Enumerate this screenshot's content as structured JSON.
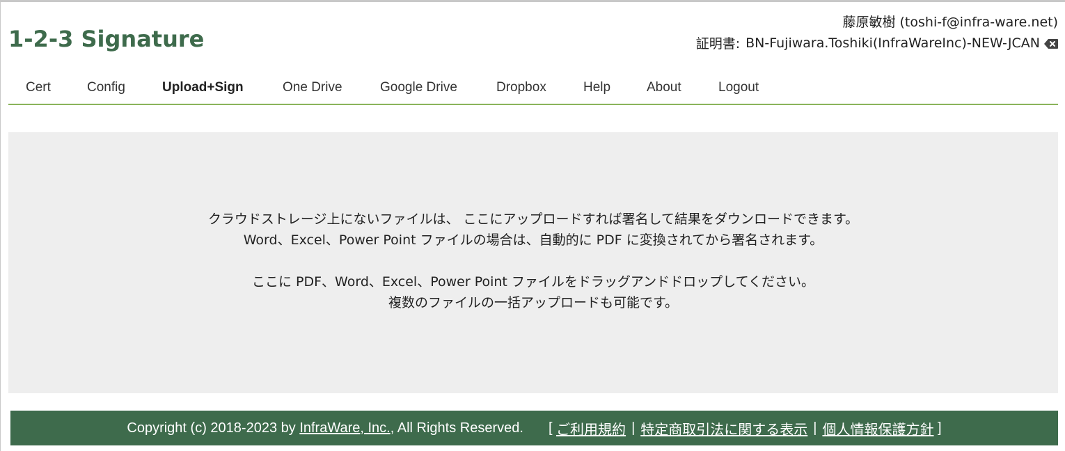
{
  "header": {
    "app_title": "1-2-3 Signature",
    "user": "藤原敏樹 (toshi-f@infra-ware.net)",
    "cert_label": "証明書:",
    "cert_name": "BN-Fujiwara.Toshiki(InfraWareInc)-NEW-JCAN",
    "cert_clear_icon": "backspace-icon"
  },
  "nav": {
    "items": [
      {
        "label": "Cert"
      },
      {
        "label": "Config"
      },
      {
        "label": "Upload+Sign",
        "active": true
      },
      {
        "label": "One Drive"
      },
      {
        "label": "Google Drive"
      },
      {
        "label": "Dropbox"
      },
      {
        "label": "Help"
      },
      {
        "label": "About"
      },
      {
        "label": "Logout"
      }
    ]
  },
  "drop_zone": {
    "line1": "クラウドストレージ上にないファイルは、 ここにアップロードすれば署名して結果をダウンロードできます。",
    "line2": "Word、Excel、Power Point ファイルの場合は、自動的に PDF に変換されてから署名されます。",
    "line3": "ここに PDF、Word、Excel、Power Point ファイルをドラッグアンドドロップしてください。",
    "line4": "複数のファイルの一括アップロードも可能です。"
  },
  "footer": {
    "copyright_prefix": "Copyright (c) 2018-2023 by",
    "company_link": "InfraWare, Inc.",
    "copyright_suffix": ", All Rights Reserved.",
    "bracket_open": "[",
    "terms_link": "ご利用規約",
    "separator": "|",
    "commerce_link": "特定商取引法に関する表示",
    "privacy_link": "個人情報保護方針",
    "bracket_close": "]"
  },
  "colors": {
    "brand_green": "#3e6b4c",
    "nav_underline": "#8ab45b",
    "drop_bg": "#eeeeee"
  }
}
